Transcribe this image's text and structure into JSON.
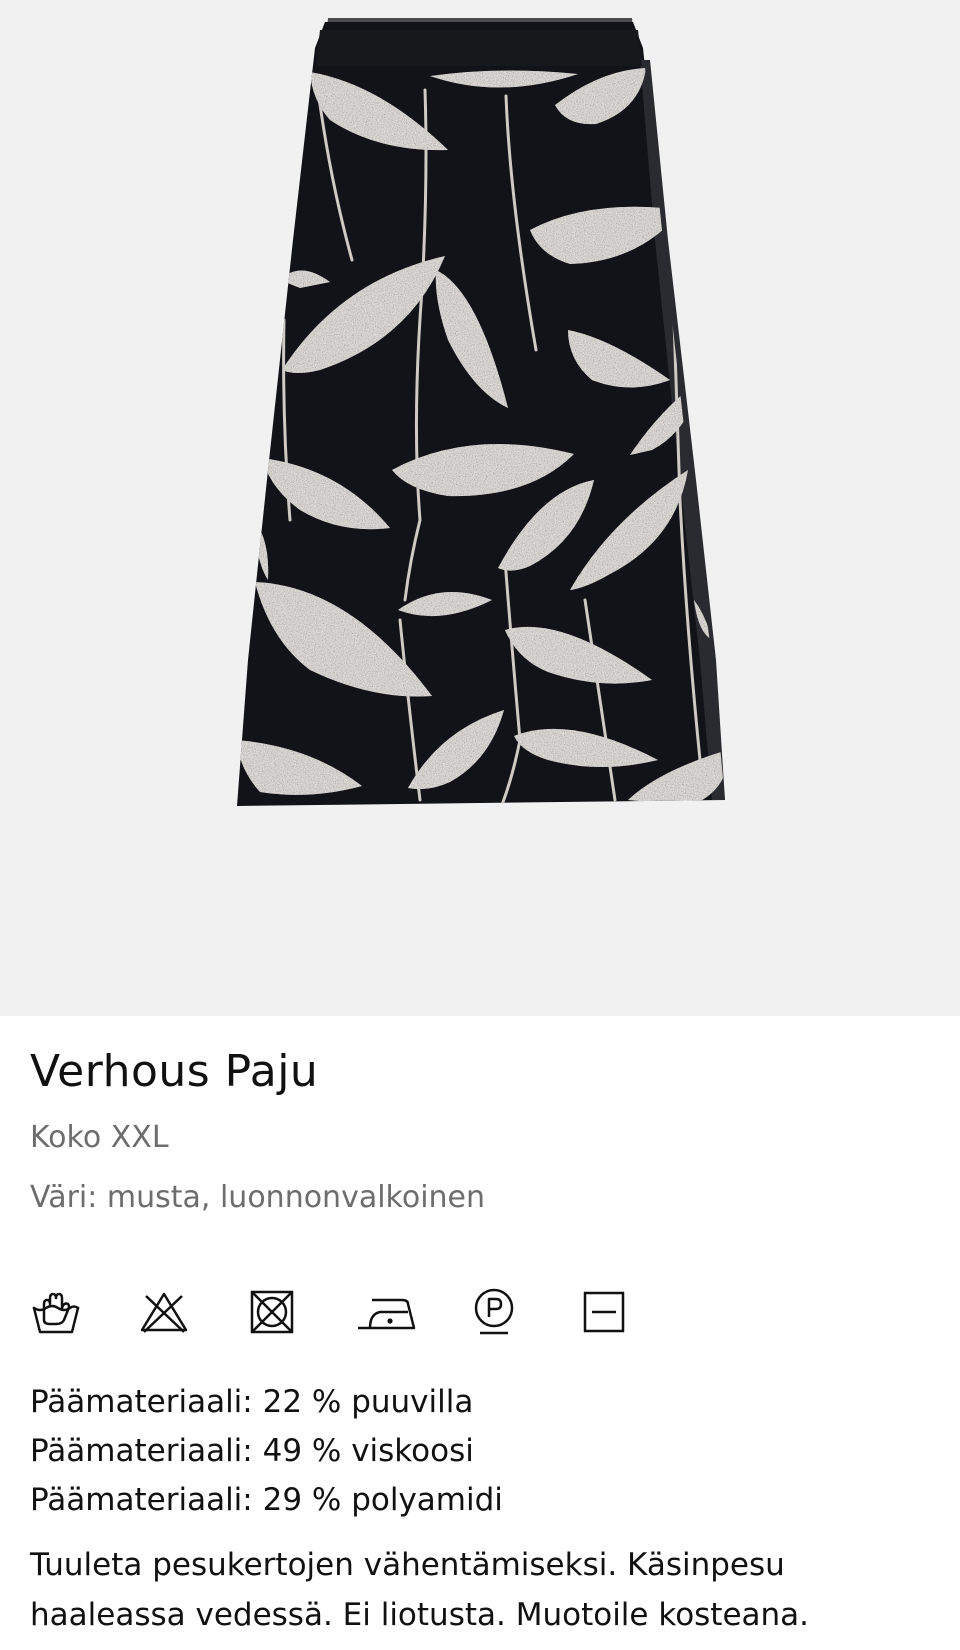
{
  "product": {
    "image_alt": "Verhous Paju",
    "name": "Verhous Paju",
    "size": "Koko XXL",
    "color": "Väri: musta, luonnonvalkoinen"
  },
  "care_icons": [
    {
      "name": "hand-wash-icon",
      "meaning": "hand wash"
    },
    {
      "name": "no-bleach-icon",
      "meaning": "do not bleach"
    },
    {
      "name": "no-tumble-dry-icon",
      "meaning": "do not tumble dry"
    },
    {
      "name": "iron-low-icon",
      "meaning": "iron low"
    },
    {
      "name": "dry-clean-p-icon",
      "meaning": "professional dry clean P"
    },
    {
      "name": "dry-flat-icon",
      "meaning": "dry flat"
    }
  ],
  "materials": [
    "Päämateriaali: 22 % puuvilla",
    "Päämateriaali: 49 % viskoosi",
    "Päämateriaali: 29 % polyamidi"
  ],
  "care_text": "Tuuleta pesukertojen vähentämiseksi. Käsinpesu haaleassa vedessä. Ei liotusta. Muotoile kosteana.",
  "colors": {
    "image_bg": "#f1f1f1",
    "skirt": "#121318",
    "leaf": "#e0dcd6",
    "text_primary": "#111111",
    "text_secondary": "#6d6d6d"
  }
}
